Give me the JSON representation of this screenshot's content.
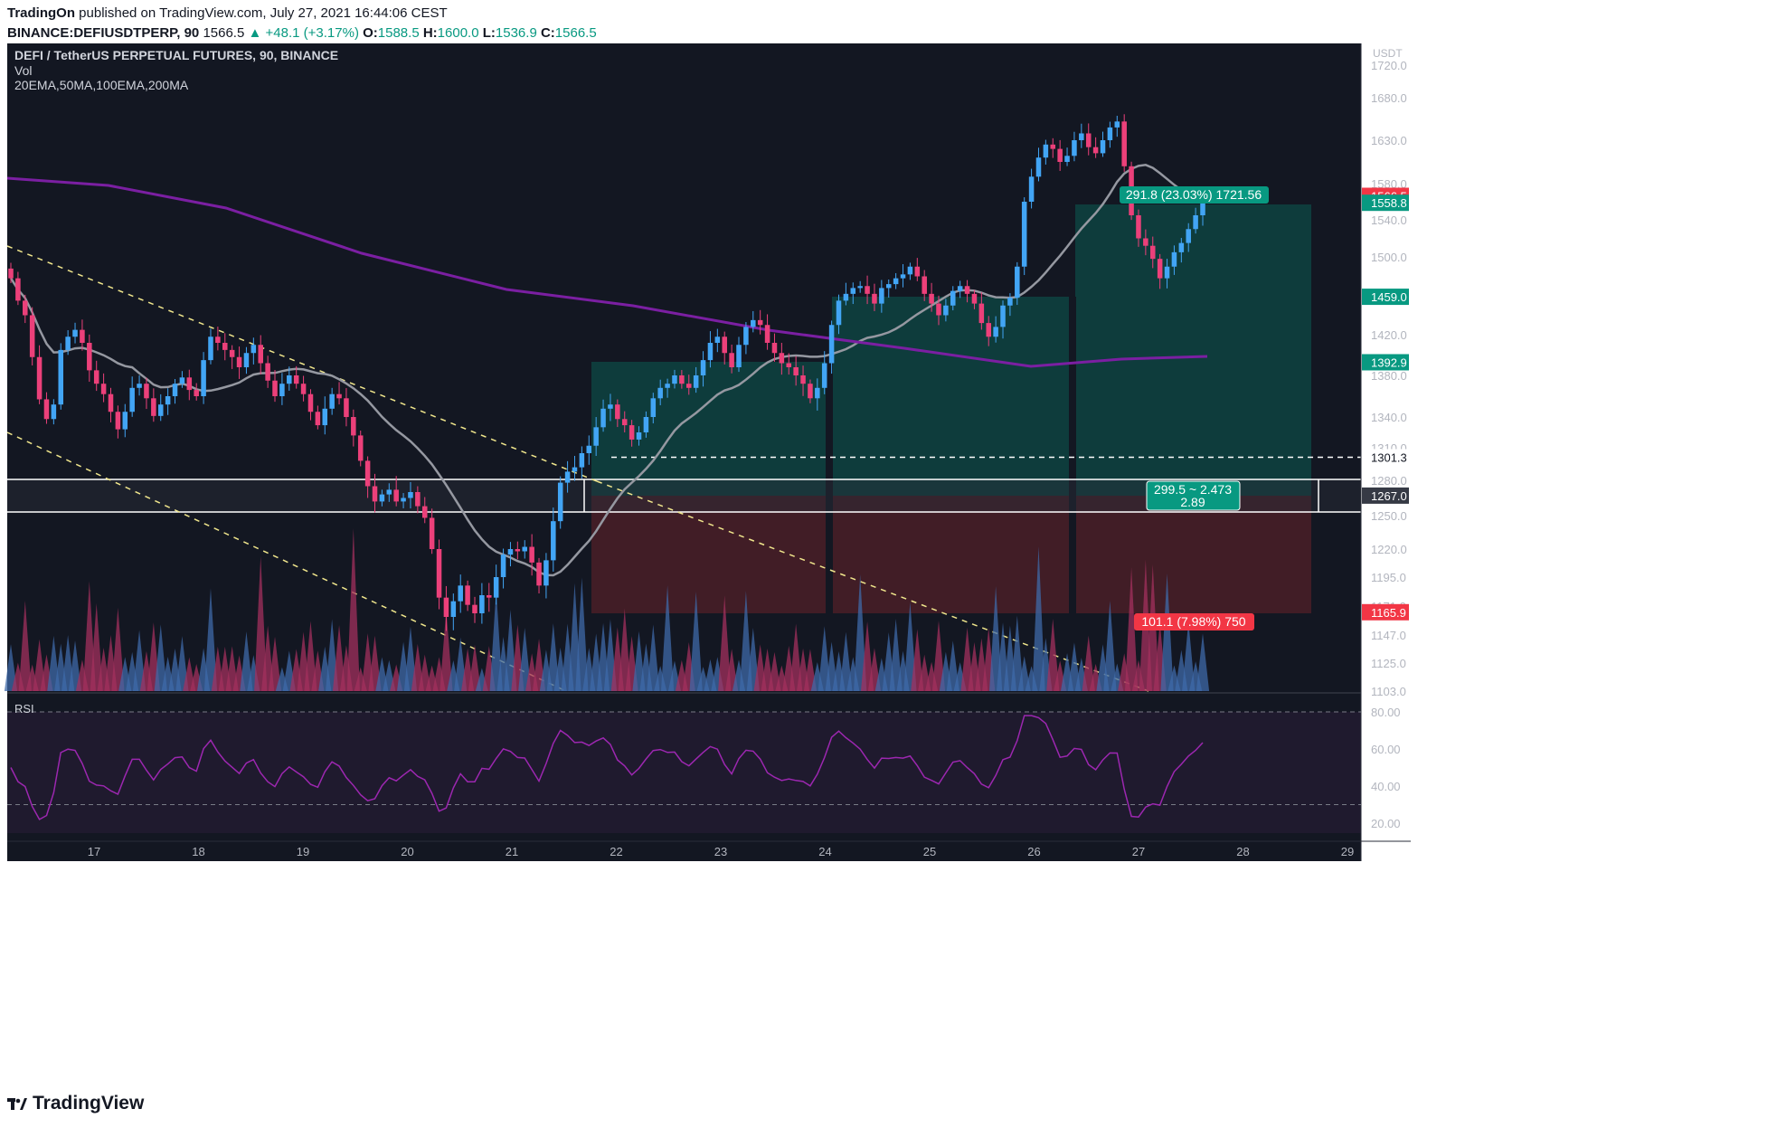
{
  "header": {
    "publisher": "TradingOn",
    "published_text": "published on TradingView.com, July 27, 2021 16:44:06 CEST",
    "symbol": "BINANCE:DEFIUSDTPERP, 90",
    "last": "1566.5",
    "change": "+48.1 (+3.17%)",
    "o_label": "O:",
    "o": "1588.5",
    "h_label": "H:",
    "h": "1600.0",
    "l_label": "L:",
    "l": "1536.9",
    "c_label": "C:",
    "c": "1566.5"
  },
  "legend": {
    "title": "DEFI / TetherUS PERPETUAL FUTURES, 90, BINANCE",
    "vol": "Vol",
    "mas": "20EMA,50MA,100EMA,200MA"
  },
  "rsi_label": "RSI",
  "currency": "USDT",
  "footer_brand": "TradingView",
  "colors": {
    "background": "#131722",
    "up": "#42a5f5",
    "down": "#ec407a",
    "ma50": "#9598a1",
    "ma200": "#7b1fa2",
    "rsi_line": "#9c27b0",
    "target_zone": "#0d4a46",
    "stop_zone": "#4a1f27",
    "badge_green": "#089981",
    "badge_red": "#f23645"
  },
  "chart_data": {
    "type": "candlestick",
    "title": "DEFI / TetherUS PERPETUAL FUTURES, 90, BINANCE",
    "price_axis": {
      "ticks": [
        "1720.0",
        "1680.0",
        "1630.0",
        "1580.0",
        "1540.0",
        "1500.0",
        "1420.0",
        "1380.0",
        "1340.0",
        "1310.0",
        "1280.0",
        "1250.0",
        "1220.0",
        "1195.0",
        "1171.0",
        "1147.0",
        "1125.0",
        "1103.0"
      ],
      "tick_values": [
        1720,
        1680,
        1630,
        1580,
        1540,
        1500,
        1420,
        1380,
        1340,
        1310,
        1280,
        1250,
        1220,
        1195,
        1171,
        1147,
        1125,
        1103
      ],
      "labels": [
        {
          "text": "1566.5",
          "value": 1566.5,
          "color": "#f23645"
        },
        {
          "text": "1558.8",
          "value": 1558.8,
          "color": "#089981"
        },
        {
          "text": "1459.0",
          "value": 1459.0,
          "color": "#089981"
        },
        {
          "text": "1392.9",
          "value": 1392.9,
          "color": "#089981"
        },
        {
          "text": "1301.3",
          "value": 1301.3,
          "color": "#ffffff"
        },
        {
          "text": "1267.0",
          "value": 1267.0,
          "color": "#363a45"
        },
        {
          "text": "1165.9",
          "value": 1165.9,
          "color": "#f23645"
        }
      ]
    },
    "time_axis": {
      "labels": [
        "17",
        "18",
        "19",
        "20",
        "21",
        "22",
        "23",
        "24",
        "25",
        "26",
        "27",
        "28",
        "29"
      ],
      "positions": [
        1,
        2,
        3,
        4,
        5,
        6,
        7,
        8,
        9,
        10,
        11,
        12,
        13
      ]
    },
    "series": [
      {
        "name": "DEFI/USDT",
        "type": "candlestick",
        "close": [
          1478,
          1455,
          1440,
          1398,
          1357,
          1338,
          1352,
          1405,
          1418,
          1425,
          1412,
          1385,
          1372,
          1362,
          1345,
          1328,
          1345,
          1368,
          1372,
          1358,
          1341,
          1352,
          1360,
          1372,
          1378,
          1366,
          1360,
          1395,
          1418,
          1412,
          1405,
          1398,
          1388,
          1402,
          1410,
          1392,
          1375,
          1360,
          1372,
          1380,
          1372,
          1362,
          1345,
          1332,
          1348,
          1362,
          1358,
          1340,
          1322,
          1298,
          1275,
          1262,
          1268,
          1272,
          1262,
          1265,
          1270,
          1258,
          1248,
          1220,
          1178,
          1162,
          1175,
          1188,
          1172,
          1165,
          1180,
          1178,
          1195,
          1215,
          1220,
          1218,
          1222,
          1208,
          1188,
          1210,
          1245,
          1278,
          1288,
          1292,
          1305,
          1312,
          1330,
          1348,
          1352,
          1338,
          1332,
          1318,
          1325,
          1340,
          1358,
          1368,
          1372,
          1380,
          1372,
          1368,
          1380,
          1395,
          1412,
          1418,
          1402,
          1388,
          1410,
          1428,
          1435,
          1430,
          1412,
          1402,
          1392,
          1388,
          1380,
          1372,
          1358,
          1368,
          1392,
          1430,
          1455,
          1462,
          1468,
          1470,
          1462,
          1452,
          1468,
          1472,
          1478,
          1482,
          1490,
          1480,
          1462,
          1452,
          1440,
          1450,
          1465,
          1470,
          1462,
          1452,
          1432,
          1418,
          1428,
          1450,
          1458,
          1490,
          1560,
          1588,
          1610,
          1625,
          1620,
          1605,
          1612,
          1630,
          1638,
          1622,
          1615,
          1630,
          1645,
          1652,
          1600,
          1545,
          1520,
          1512,
          1498,
          1478,
          1490,
          1505,
          1515,
          1530,
          1545,
          1566
        ],
        "note": "approximate closes read from chart"
      }
    ],
    "indicators": [
      "20EMA",
      "50MA",
      "100EMA",
      "200MA",
      "Vol",
      "RSI"
    ],
    "annotations": [
      {
        "text": "291.8 (23.03%) 1721.56",
        "kind": "target"
      },
      {
        "text": "299.5 ~ 2.473",
        "kind": "position"
      },
      {
        "text": "2.89",
        "kind": "ratio"
      },
      {
        "text": "101.1 (7.98%) 750",
        "kind": "stop"
      }
    ],
    "rsi": {
      "ticks": [
        "80.00",
        "60.00",
        "40.00",
        "20.00"
      ],
      "tick_values": [
        80,
        60,
        40,
        20
      ]
    },
    "grid": false
  }
}
